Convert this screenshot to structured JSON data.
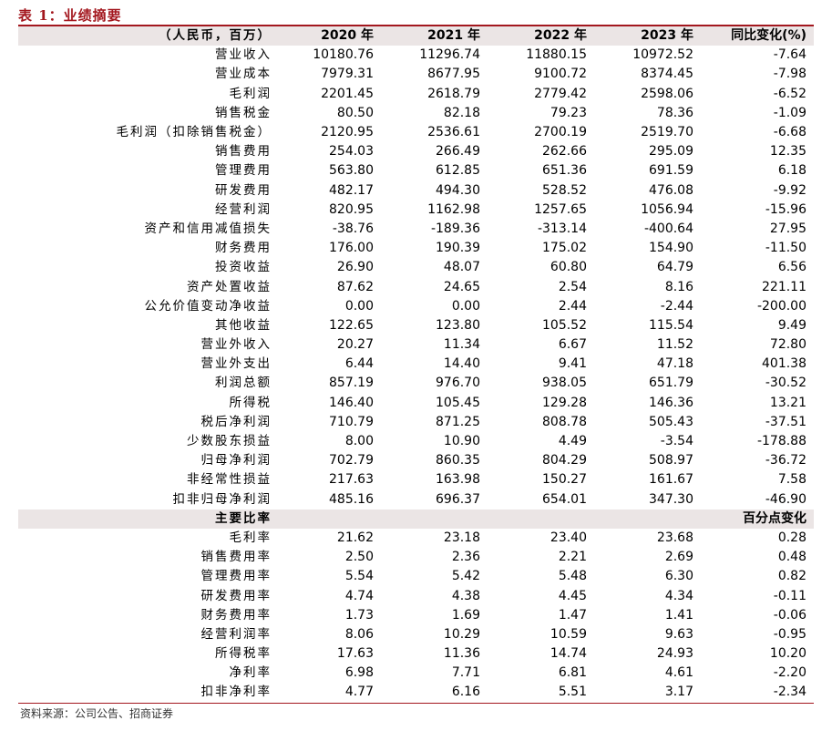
{
  "title": "表 1：业绩摘要",
  "header": [
    "（人民币，百万）",
    "2020 年",
    "2021 年",
    "2022 年",
    "2023 年",
    "同比变化(%)"
  ],
  "rows": [
    [
      "营业收入",
      "10180.76",
      "11296.74",
      "11880.15",
      "10972.52",
      "-7.64"
    ],
    [
      "营业成本",
      "7979.31",
      "8677.95",
      "9100.72",
      "8374.45",
      "-7.98"
    ],
    [
      "毛利润",
      "2201.45",
      "2618.79",
      "2779.42",
      "2598.06",
      "-6.52"
    ],
    [
      "销售税金",
      "80.50",
      "82.18",
      "79.23",
      "78.36",
      "-1.09"
    ],
    [
      "毛利润（扣除销售税金）",
      "2120.95",
      "2536.61",
      "2700.19",
      "2519.70",
      "-6.68"
    ],
    [
      "销售费用",
      "254.03",
      "266.49",
      "262.66",
      "295.09",
      "12.35"
    ],
    [
      "管理费用",
      "563.80",
      "612.85",
      "651.36",
      "691.59",
      "6.18"
    ],
    [
      "研发费用",
      "482.17",
      "494.30",
      "528.52",
      "476.08",
      "-9.92"
    ],
    [
      "经营利润",
      "820.95",
      "1162.98",
      "1257.65",
      "1056.94",
      "-15.96"
    ],
    [
      "资产和信用减值损失",
      "-38.76",
      "-189.36",
      "-313.14",
      "-400.64",
      "27.95"
    ],
    [
      "财务费用",
      "176.00",
      "190.39",
      "175.02",
      "154.90",
      "-11.50"
    ],
    [
      "投资收益",
      "26.90",
      "48.07",
      "60.80",
      "64.79",
      "6.56"
    ],
    [
      "资产处置收益",
      "87.62",
      "24.65",
      "2.54",
      "8.16",
      "221.11"
    ],
    [
      "公允价值变动净收益",
      "0.00",
      "0.00",
      "2.44",
      "-2.44",
      "-200.00"
    ],
    [
      "其他收益",
      "122.65",
      "123.80",
      "105.52",
      "115.54",
      "9.49"
    ],
    [
      "营业外收入",
      "20.27",
      "11.34",
      "6.67",
      "11.52",
      "72.80"
    ],
    [
      "营业外支出",
      "6.44",
      "14.40",
      "9.41",
      "47.18",
      "401.38"
    ],
    [
      "利润总额",
      "857.19",
      "976.70",
      "938.05",
      "651.79",
      "-30.52"
    ],
    [
      "所得税",
      "146.40",
      "105.45",
      "129.28",
      "146.36",
      "13.21"
    ],
    [
      "税后净利润",
      "710.79",
      "871.25",
      "808.78",
      "505.43",
      "-37.51"
    ],
    [
      "少数股东损益",
      "8.00",
      "10.90",
      "4.49",
      "-3.54",
      "-178.88"
    ],
    [
      "归母净利润",
      "702.79",
      "860.35",
      "804.29",
      "508.97",
      "-36.72"
    ],
    [
      "非经常性损益",
      "217.63",
      "163.98",
      "150.27",
      "161.67",
      "7.58"
    ],
    [
      "扣非归母净利润",
      "485.16",
      "696.37",
      "654.01",
      "347.30",
      "-46.90"
    ]
  ],
  "ratio_section": {
    "label": "主要比率",
    "change_label": "百分点变化"
  },
  "ratio_rows": [
    [
      "毛利率",
      "21.62",
      "23.18",
      "23.40",
      "23.68",
      "0.28"
    ],
    [
      "销售费用率",
      "2.50",
      "2.36",
      "2.21",
      "2.69",
      "0.48"
    ],
    [
      "管理费用率",
      "5.54",
      "5.42",
      "5.48",
      "6.30",
      "0.82"
    ],
    [
      "研发费用率",
      "4.74",
      "4.38",
      "4.45",
      "4.34",
      "-0.11"
    ],
    [
      "财务费用率",
      "1.73",
      "1.69",
      "1.47",
      "1.41",
      "-0.06"
    ],
    [
      "经营利润率",
      "8.06",
      "10.29",
      "10.59",
      "9.63",
      "-0.95"
    ],
    [
      "所得税率",
      "17.63",
      "11.36",
      "14.74",
      "24.93",
      "10.20"
    ],
    [
      "净利率",
      "6.98",
      "7.71",
      "6.81",
      "4.61",
      "-2.20"
    ],
    [
      "扣非净利率",
      "4.77",
      "6.16",
      "5.51",
      "3.17",
      "-2.34"
    ]
  ],
  "source": "资料来源：公司公告、招商证券",
  "colors": {
    "accent": "#a3171e",
    "header_bg": "#ebe5e5"
  }
}
